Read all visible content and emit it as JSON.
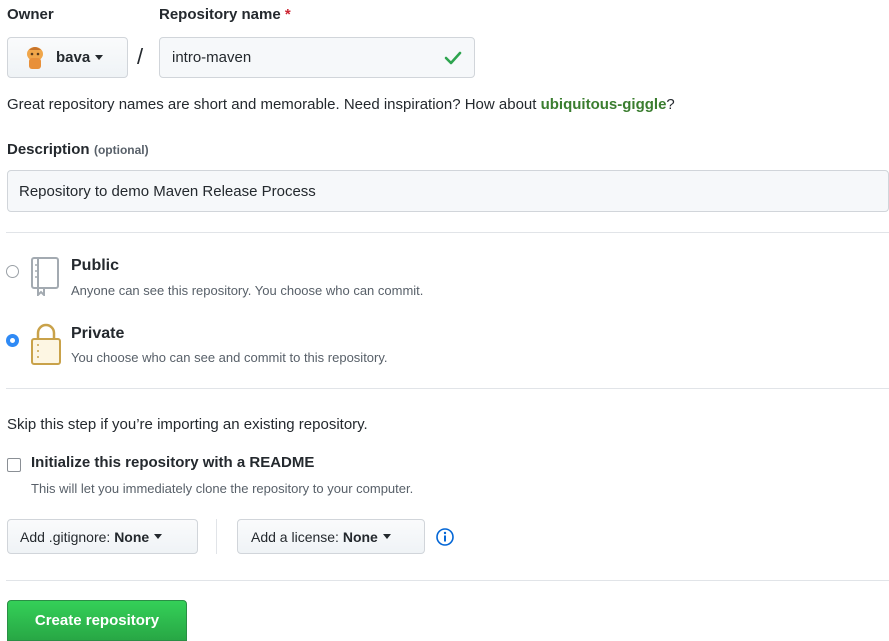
{
  "owner": {
    "label": "Owner",
    "selected": "bava",
    "avatar_icon": "user-avatar-icon"
  },
  "repo_name": {
    "label": "Repository name",
    "required_mark": "*",
    "value": "intro-maven",
    "valid_icon": "checkmark-icon"
  },
  "separator": "/",
  "hint": {
    "text": "Great repository names are short and memorable. Need inspiration? How about ",
    "suggestion": "ubiquitous-giggle",
    "end": "?"
  },
  "description": {
    "label": "Description",
    "optional": "(optional)",
    "value": "Repository to demo Maven Release Process"
  },
  "visibility": {
    "options": [
      {
        "title": "Public",
        "description": "Anyone can see this repository. You choose who can commit.",
        "icon": "book-icon",
        "selected": false
      },
      {
        "title": "Private",
        "description": "You choose who can see and commit to this repository.",
        "icon": "lock-icon",
        "selected": true
      }
    ]
  },
  "skip_text": "Skip this step if you’re importing an existing repository.",
  "readme": {
    "label": "Initialize this repository with a README",
    "description": "This will let you immediately clone the repository to your computer.",
    "checked": false
  },
  "gitignore": {
    "label": "Add .gitignore:",
    "value": "None"
  },
  "license": {
    "label": "Add a license:",
    "value": "None",
    "info_icon": "info-icon"
  },
  "submit": {
    "label": "Create repository"
  },
  "colors": {
    "primary_green": "#2ea44f",
    "link_green": "#3a7d2f",
    "required_red": "#cb2431",
    "radio_blue": "#2f8af5",
    "info_blue": "#0366d6"
  }
}
